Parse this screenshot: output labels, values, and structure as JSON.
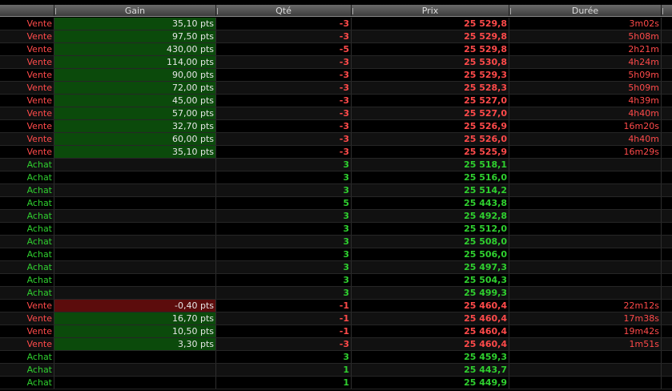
{
  "header": {
    "columns": [
      "",
      "Gain",
      "Qté",
      "Prix",
      "Durée"
    ]
  },
  "rows": [
    {
      "side": "Vente",
      "gain": "35,10 pts",
      "qty": "-3",
      "price": "25 529,8",
      "duration": "3m02s"
    },
    {
      "side": "Vente",
      "gain": "97,50 pts",
      "qty": "-3",
      "price": "25 529,8",
      "duration": "5h08m"
    },
    {
      "side": "Vente",
      "gain": "430,00 pts",
      "qty": "-5",
      "price": "25 529,8",
      "duration": "2h21m"
    },
    {
      "side": "Vente",
      "gain": "114,00 pts",
      "qty": "-3",
      "price": "25 530,8",
      "duration": "4h24m"
    },
    {
      "side": "Vente",
      "gain": "90,00 pts",
      "qty": "-3",
      "price": "25 529,3",
      "duration": "5h09m"
    },
    {
      "side": "Vente",
      "gain": "72,00 pts",
      "qty": "-3",
      "price": "25 528,3",
      "duration": "5h09m"
    },
    {
      "side": "Vente",
      "gain": "45,00 pts",
      "qty": "-3",
      "price": "25 527,0",
      "duration": "4h39m"
    },
    {
      "side": "Vente",
      "gain": "57,00 pts",
      "qty": "-3",
      "price": "25 527,0",
      "duration": "4h40m"
    },
    {
      "side": "Vente",
      "gain": "32,70 pts",
      "qty": "-3",
      "price": "25 526,9",
      "duration": "16m20s"
    },
    {
      "side": "Vente",
      "gain": "60,00 pts",
      "qty": "-3",
      "price": "25 526,0",
      "duration": "4h40m"
    },
    {
      "side": "Vente",
      "gain": "35,10 pts",
      "qty": "-3",
      "price": "25 525,9",
      "duration": "16m29s"
    },
    {
      "side": "Achat",
      "gain": "",
      "qty": "3",
      "price": "25 518,1",
      "duration": ""
    },
    {
      "side": "Achat",
      "gain": "",
      "qty": "3",
      "price": "25 516,0",
      "duration": ""
    },
    {
      "side": "Achat",
      "gain": "",
      "qty": "3",
      "price": "25 514,2",
      "duration": ""
    },
    {
      "side": "Achat",
      "gain": "",
      "qty": "5",
      "price": "25 443,8",
      "duration": ""
    },
    {
      "side": "Achat",
      "gain": "",
      "qty": "3",
      "price": "25 492,8",
      "duration": ""
    },
    {
      "side": "Achat",
      "gain": "",
      "qty": "3",
      "price": "25 512,0",
      "duration": ""
    },
    {
      "side": "Achat",
      "gain": "",
      "qty": "3",
      "price": "25 508,0",
      "duration": ""
    },
    {
      "side": "Achat",
      "gain": "",
      "qty": "3",
      "price": "25 506,0",
      "duration": ""
    },
    {
      "side": "Achat",
      "gain": "",
      "qty": "3",
      "price": "25 497,3",
      "duration": ""
    },
    {
      "side": "Achat",
      "gain": "",
      "qty": "3",
      "price": "25 504,3",
      "duration": ""
    },
    {
      "side": "Achat",
      "gain": "",
      "qty": "3",
      "price": "25 499,3",
      "duration": ""
    },
    {
      "side": "Vente",
      "gain": "-0,40 pts",
      "qty": "-1",
      "price": "25 460,4",
      "duration": "22m12s"
    },
    {
      "side": "Vente",
      "gain": "16,70 pts",
      "qty": "-1",
      "price": "25 460,4",
      "duration": "17m38s"
    },
    {
      "side": "Vente",
      "gain": "10,50 pts",
      "qty": "-1",
      "price": "25 460,4",
      "duration": "19m42s"
    },
    {
      "side": "Vente",
      "gain": "3,30 pts",
      "qty": "-3",
      "price": "25 460,4",
      "duration": "1m51s"
    },
    {
      "side": "Achat",
      "gain": "",
      "qty": "3",
      "price": "25 459,3",
      "duration": ""
    },
    {
      "side": "Achat",
      "gain": "",
      "qty": "1",
      "price": "25 443,7",
      "duration": ""
    },
    {
      "side": "Achat",
      "gain": "",
      "qty": "1",
      "price": "25 449,9",
      "duration": ""
    }
  ],
  "colors": {
    "sell": "#ff4a4a",
    "buy": "#2fd02f",
    "gain_positive_bg": "#0b4a0b",
    "gain_negative_bg": "#5c0c0c"
  }
}
